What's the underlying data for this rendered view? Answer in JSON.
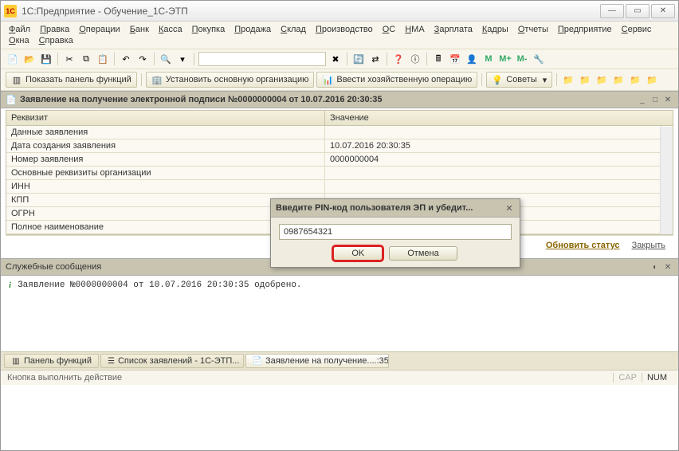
{
  "window": {
    "title": "1С:Предприятие - Обучение_1С-ЭТП",
    "app_badge": "1C"
  },
  "menu": {
    "row1": [
      "Файл",
      "Правка",
      "Операции",
      "Банк",
      "Касса",
      "Покупка",
      "Продажа",
      "Склад",
      "Производство",
      "ОС",
      "НМА",
      "Зарплата",
      "Кадры",
      "Отчеты",
      "Предприятие",
      "Сервис"
    ],
    "row2": [
      "Окна",
      "Справка"
    ]
  },
  "toolbar2": {
    "show_panel": "Показать панель функций",
    "set_org": "Установить основную организацию",
    "enter_op": "Ввести хозяйственную операцию",
    "tips": "Советы"
  },
  "doc": {
    "header": "Заявление на получение электронной подписи №0000000004 от 10.07.2016 20:30:35",
    "col_req": "Реквизит",
    "col_val": "Значение",
    "rows": [
      {
        "r": "Данные заявления",
        "v": ""
      },
      {
        "r": "Дата создания заявления",
        "v": "10.07.2016 20:30:35"
      },
      {
        "r": "Номер заявления",
        "v": "0000000004"
      },
      {
        "r": "Основные реквизиты организации",
        "v": ""
      },
      {
        "r": "ИНН",
        "v": ""
      },
      {
        "r": "КПП",
        "v": ""
      },
      {
        "r": "ОГРН",
        "v": ""
      },
      {
        "r": "Полное наименование",
        "v": ""
      }
    ],
    "update": "Обновить статус",
    "close": "Закрыть"
  },
  "messages": {
    "header": "Служебные сообщения",
    "text": "Заявление №0000000004 от 10.07.2016 20:30:35 одобрено."
  },
  "tabs": {
    "t1": "Панель функций",
    "t2": "Список заявлений - 1С-ЭТП...",
    "t3": "Заявление на получение....:35"
  },
  "status": {
    "hint": "Кнопка выполнить действие",
    "cap": "CAP",
    "num": "NUM"
  },
  "modal": {
    "title": "Введите PIN-код пользователя ЭП и убедит...",
    "value": "0987654321",
    "ok": "OK",
    "cancel": "Отмена"
  }
}
